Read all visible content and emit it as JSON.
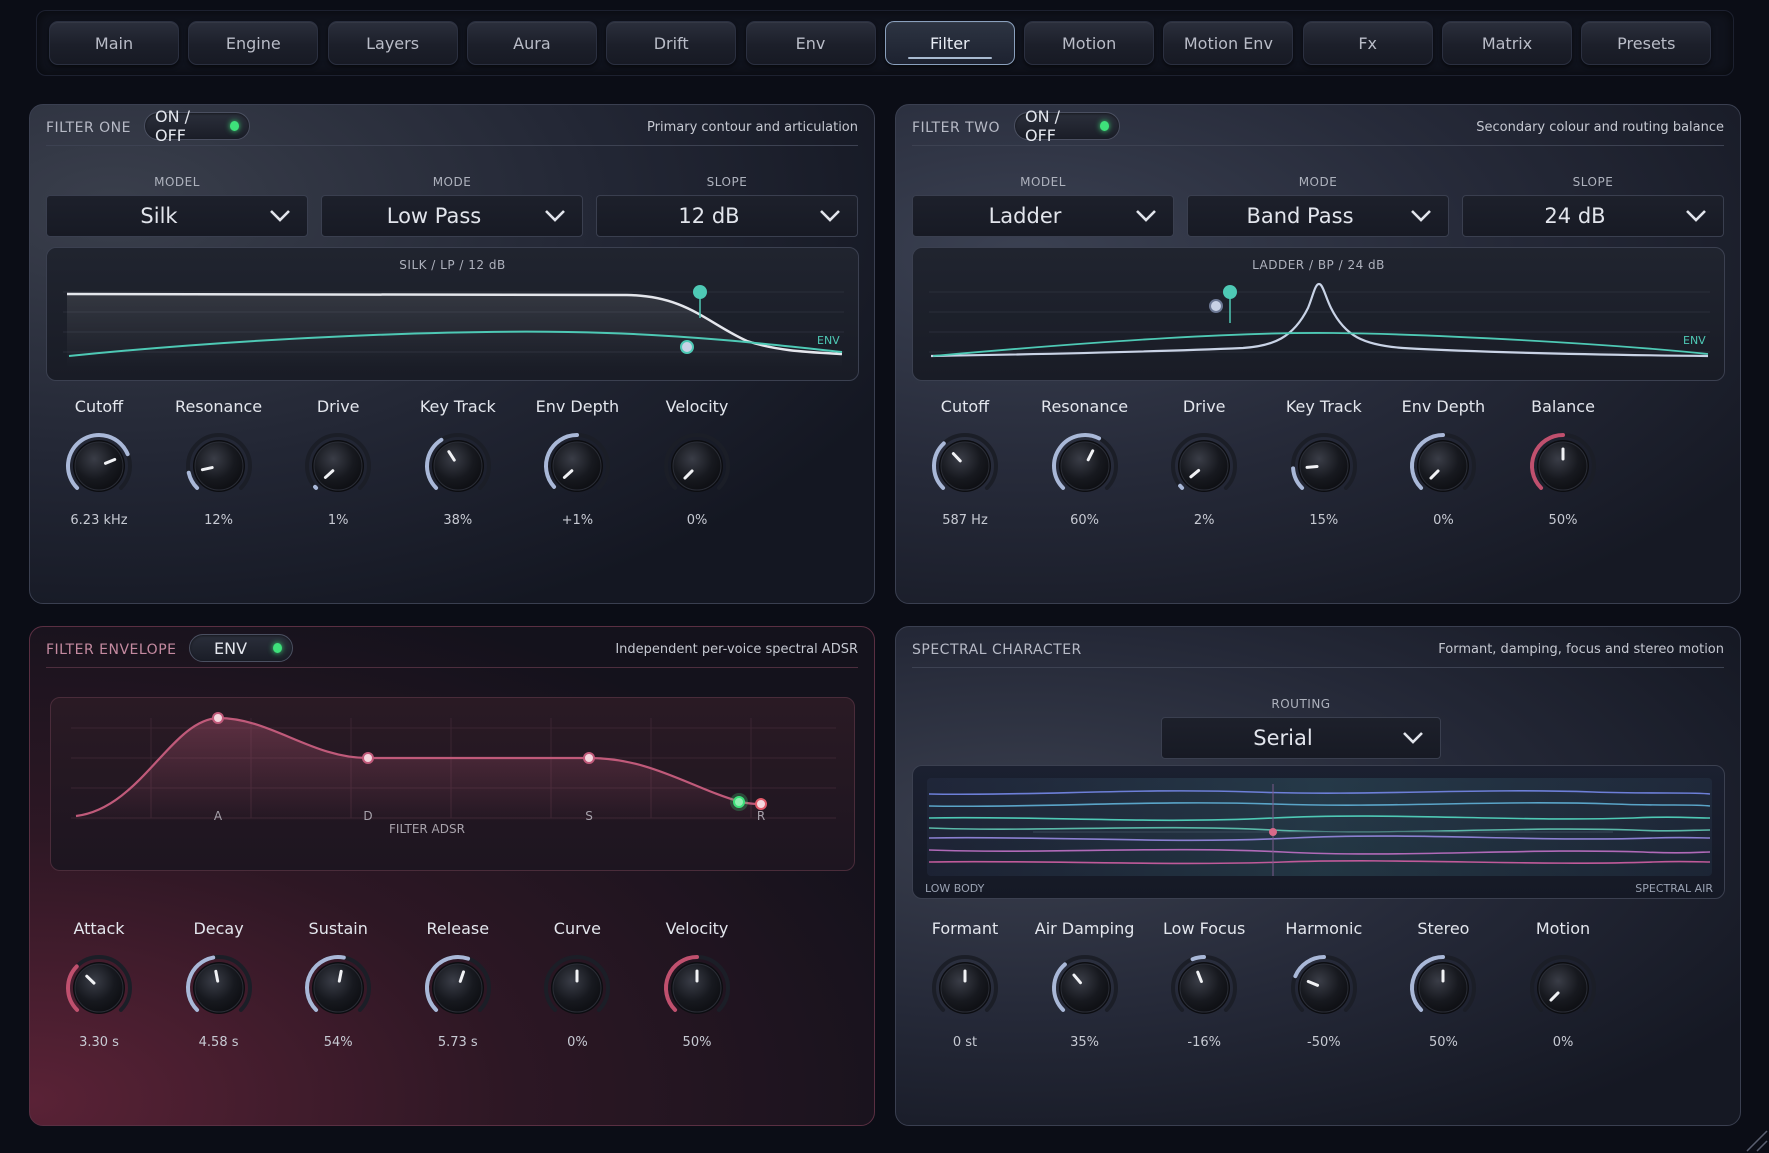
{
  "tabs": [
    {
      "label": "Main"
    },
    {
      "label": "Engine"
    },
    {
      "label": "Layers"
    },
    {
      "label": "Aura"
    },
    {
      "label": "Drift"
    },
    {
      "label": "Env"
    },
    {
      "label": "Filter",
      "active": true
    },
    {
      "label": "Motion"
    },
    {
      "label": "Motion Env"
    },
    {
      "label": "Fx"
    },
    {
      "label": "Matrix"
    },
    {
      "label": "Presets"
    }
  ],
  "filter_one": {
    "title": "FILTER ONE",
    "toggle": "ON / OFF",
    "subtitle": "Primary contour and articulation",
    "selects": [
      {
        "label": "MODEL",
        "value": "Silk"
      },
      {
        "label": "MODE",
        "value": "Low Pass"
      },
      {
        "label": "SLOPE",
        "value": "12 dB"
      }
    ],
    "graph_label": "SILK  /  LP  /  12 dB",
    "env_tag": "ENV",
    "knobs": [
      {
        "label": "Cutoff",
        "value": "6.23 kHz",
        "level": 0.75
      },
      {
        "label": "Resonance",
        "value": "12%",
        "level": 0.12
      },
      {
        "label": "Drive",
        "value": "1%",
        "level": 0.01
      },
      {
        "label": "Key Track",
        "value": "38%",
        "level": 0.38
      },
      {
        "label": "Env Depth",
        "value": "+1%",
        "level": 0.01,
        "bipolar": true
      },
      {
        "label": "Velocity",
        "value": "0%",
        "level": 0.0
      }
    ]
  },
  "filter_two": {
    "title": "FILTER TWO",
    "toggle": "ON / OFF",
    "subtitle": "Secondary colour and routing balance",
    "selects": [
      {
        "label": "MODEL",
        "value": "Ladder"
      },
      {
        "label": "MODE",
        "value": "Band Pass"
      },
      {
        "label": "SLOPE",
        "value": "24 dB"
      }
    ],
    "graph_label": "LADDER  /  BP  /  24 dB",
    "env_tag": "ENV",
    "knobs": [
      {
        "label": "Cutoff",
        "value": "587 Hz",
        "level": 0.34
      },
      {
        "label": "Resonance",
        "value": "60%",
        "level": 0.6
      },
      {
        "label": "Drive",
        "value": "2%",
        "level": 0.02
      },
      {
        "label": "Key Track",
        "value": "15%",
        "level": 0.15
      },
      {
        "label": "Env Depth",
        "value": "0%",
        "level": 0.0,
        "bipolar": true
      },
      {
        "label": "Balance",
        "value": "50%",
        "level": 0.5,
        "accent": "#c0506e"
      }
    ]
  },
  "filter_envelope": {
    "title": "FILTER ENVELOPE",
    "toggle": "ENV",
    "subtitle": "Independent per-voice spectral ADSR",
    "graph_caption": "FILTER ADSR",
    "stage_labels": [
      "A",
      "D",
      "S",
      "R"
    ],
    "knobs": [
      {
        "label": "Attack",
        "value": "3.30 s",
        "level": 0.33,
        "accent": "#c0506e"
      },
      {
        "label": "Decay",
        "value": "4.58 s",
        "level": 0.46
      },
      {
        "label": "Sustain",
        "value": "54%",
        "level": 0.54
      },
      {
        "label": "Release",
        "value": "5.73 s",
        "level": 0.57
      },
      {
        "label": "Curve",
        "value": "0%",
        "level": 0.5,
        "bipolar": true
      },
      {
        "label": "Velocity",
        "value": "50%",
        "level": 0.5,
        "accent": "#c0506e"
      }
    ]
  },
  "spectral": {
    "title": "SPECTRAL CHARACTER",
    "subtitle": "Formant, damping, focus and stereo motion",
    "routing_label": "ROUTING",
    "routing_value": "Serial",
    "low_label": "LOW BODY",
    "high_label": "SPECTRAL AIR",
    "knobs": [
      {
        "label": "Formant",
        "value": "0 st",
        "level": 0.5,
        "bipolar": true
      },
      {
        "label": "Air Damping",
        "value": "35%",
        "level": 0.35
      },
      {
        "label": "Low Focus",
        "value": "-16%",
        "level": 0.42,
        "bipolar": true
      },
      {
        "label": "Harmonic",
        "value": "-50%",
        "level": 0.25,
        "bipolar": true
      },
      {
        "label": "Stereo",
        "value": "50%",
        "level": 0.5
      },
      {
        "label": "Motion",
        "value": "0%",
        "level": 0.0
      }
    ]
  },
  "colors": {
    "teal": "#4ec9b5",
    "arc": "#a9b8d8",
    "pink": "#c0506e",
    "env_line": "#c05a7a",
    "led": "#3ee07a"
  }
}
